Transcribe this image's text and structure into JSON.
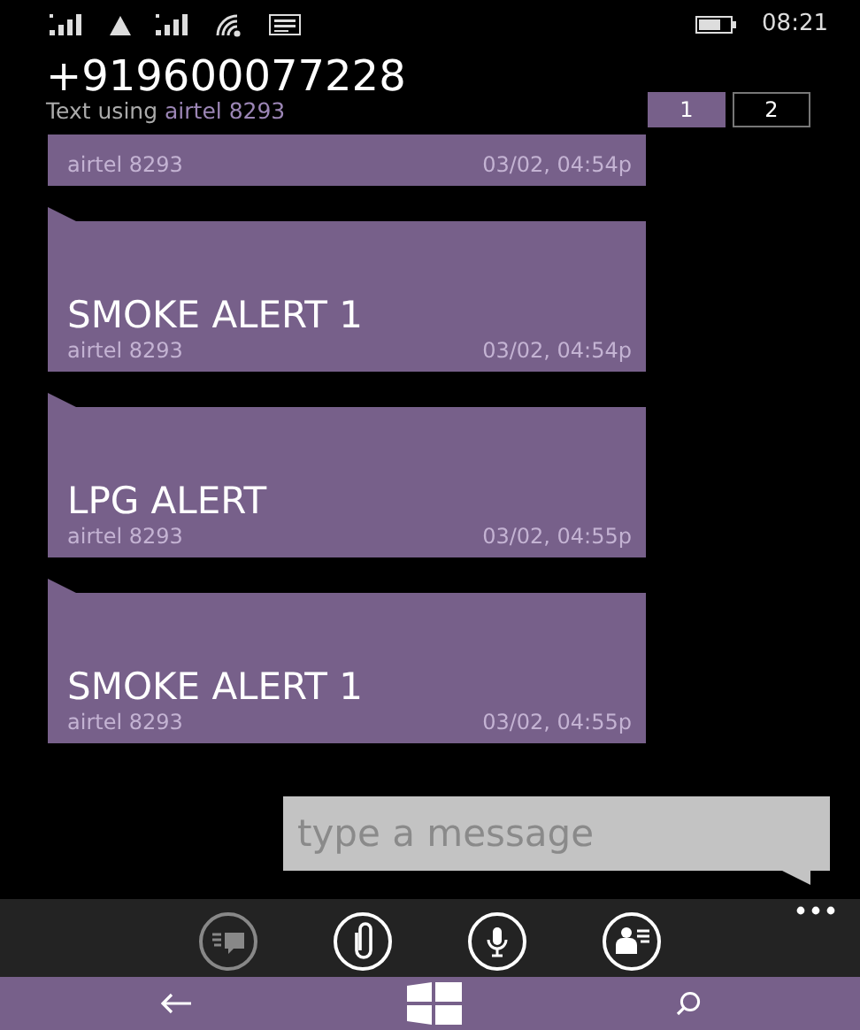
{
  "status_bar": {
    "time": "08:21"
  },
  "header": {
    "title": "+919600077228",
    "subtitle_prefix": "Text using",
    "sim": "airtel 8293"
  },
  "sim_tabs": [
    {
      "label": "1",
      "selected": true
    },
    {
      "label": "2",
      "selected": false
    }
  ],
  "messages": [
    {
      "sender": "airtel 8293",
      "time": "03/02, 04:54p",
      "cut": true
    },
    {
      "text": "SMOKE ALERT 1",
      "sender": "airtel 8293",
      "time": "03/02, 04:54p",
      "cut": false
    },
    {
      "text": "LPG ALERT",
      "sender": "airtel 8293",
      "time": "03/02, 04:55p",
      "cut": false
    },
    {
      "text": "SMOKE ALERT 1",
      "sender": "airtel 8293",
      "time": "03/02, 04:55p",
      "cut": false
    }
  ],
  "compose": {
    "placeholder": "type a message"
  },
  "app_bar": [
    {
      "kind": "sim",
      "disabled": true
    },
    {
      "kind": "attach",
      "disabled": false
    },
    {
      "kind": "voice",
      "disabled": false
    },
    {
      "kind": "contact",
      "disabled": false
    }
  ]
}
